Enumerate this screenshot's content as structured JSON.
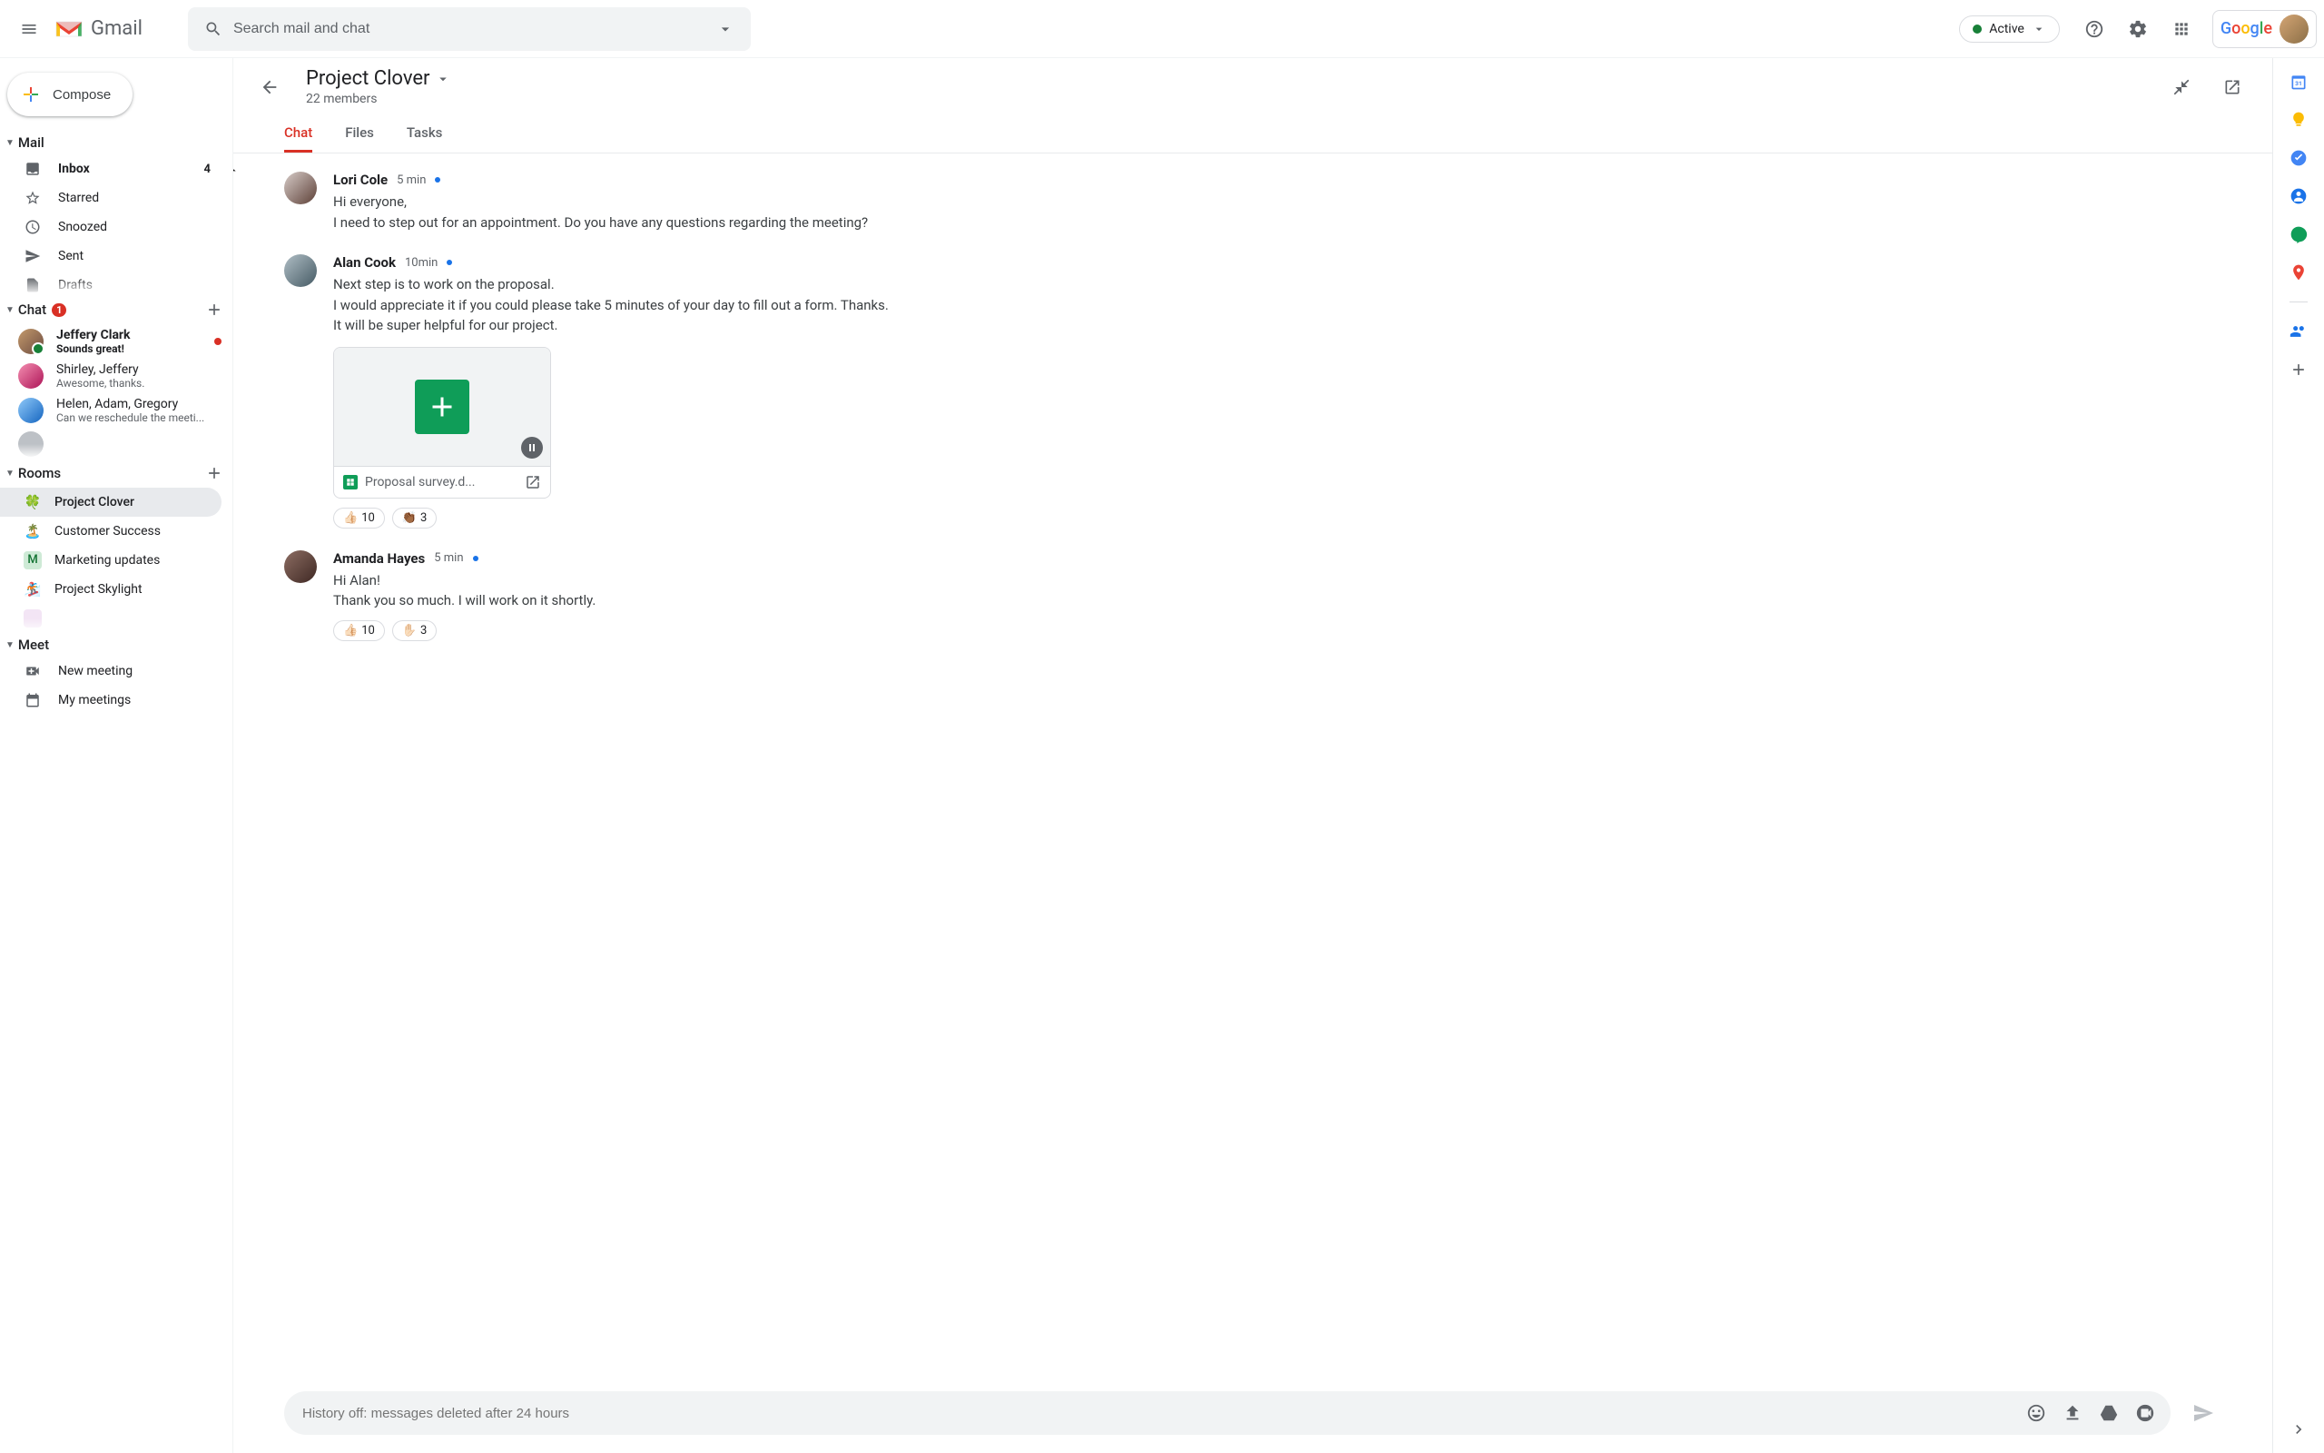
{
  "header": {
    "logo_text": "Gmail",
    "search_placeholder": "Search mail and chat",
    "status_label": "Active"
  },
  "compose_label": "Compose",
  "mail_section": {
    "title": "Mail",
    "items": [
      {
        "label": "Inbox",
        "count": "4"
      },
      {
        "label": "Starred"
      },
      {
        "label": "Snoozed"
      },
      {
        "label": "Sent"
      },
      {
        "label": "Drafts"
      }
    ]
  },
  "chat_section": {
    "title": "Chat",
    "badge": "1",
    "items": [
      {
        "name": "Jeffery Clark",
        "snippet": "Sounds great!",
        "unread": true,
        "online": true
      },
      {
        "name": "Shirley, Jeffery",
        "snippet": "Awesome, thanks."
      },
      {
        "name": "Helen, Adam, Gregory",
        "snippet": "Can we reschedule the meeti..."
      }
    ]
  },
  "rooms_section": {
    "title": "Rooms",
    "items": [
      {
        "emoji": "🍀",
        "label": "Project Clover",
        "active": true
      },
      {
        "emoji": "🏝️",
        "label": "Customer Success"
      },
      {
        "emoji": "M",
        "label": "Marketing updates",
        "letter": true
      },
      {
        "emoji": "🏂",
        "label": "Project Skylight"
      }
    ]
  },
  "meet_section": {
    "title": "Meet",
    "items": [
      {
        "label": "New meeting"
      },
      {
        "label": "My meetings"
      }
    ]
  },
  "conversation": {
    "title": "Project Clover",
    "subtitle": "22 members",
    "tabs": [
      {
        "label": "Chat",
        "active": true
      },
      {
        "label": "Files"
      },
      {
        "label": "Tasks"
      }
    ],
    "messages": [
      {
        "name": "Lori Cole",
        "time": "5 min",
        "lines": [
          "Hi everyone,",
          "I need to step out for an appointment. Do you have any questions regarding the meeting?"
        ]
      },
      {
        "name": "Alan Cook",
        "time": "10min",
        "lines": [
          "Next step is to work on the proposal.",
          "I would appreciate it if you could please take 5 minutes of your day to fill out a form. Thanks.",
          "It will be super helpful for our project."
        ],
        "attachment": {
          "name": "Proposal survey.d..."
        },
        "reactions": [
          {
            "emoji": "👍🏻",
            "count": "10"
          },
          {
            "emoji": "👏🏾",
            "count": "3"
          }
        ]
      },
      {
        "name": "Amanda Hayes",
        "time": "5 min",
        "lines": [
          "Hi Alan!",
          "Thank you so much. I will work on it shortly."
        ],
        "reactions": [
          {
            "emoji": "👍🏻",
            "count": "10"
          },
          {
            "emoji": "✋🏻",
            "count": "3"
          }
        ]
      }
    ],
    "composer_placeholder": "History off: messages deleted after 24 hours"
  }
}
